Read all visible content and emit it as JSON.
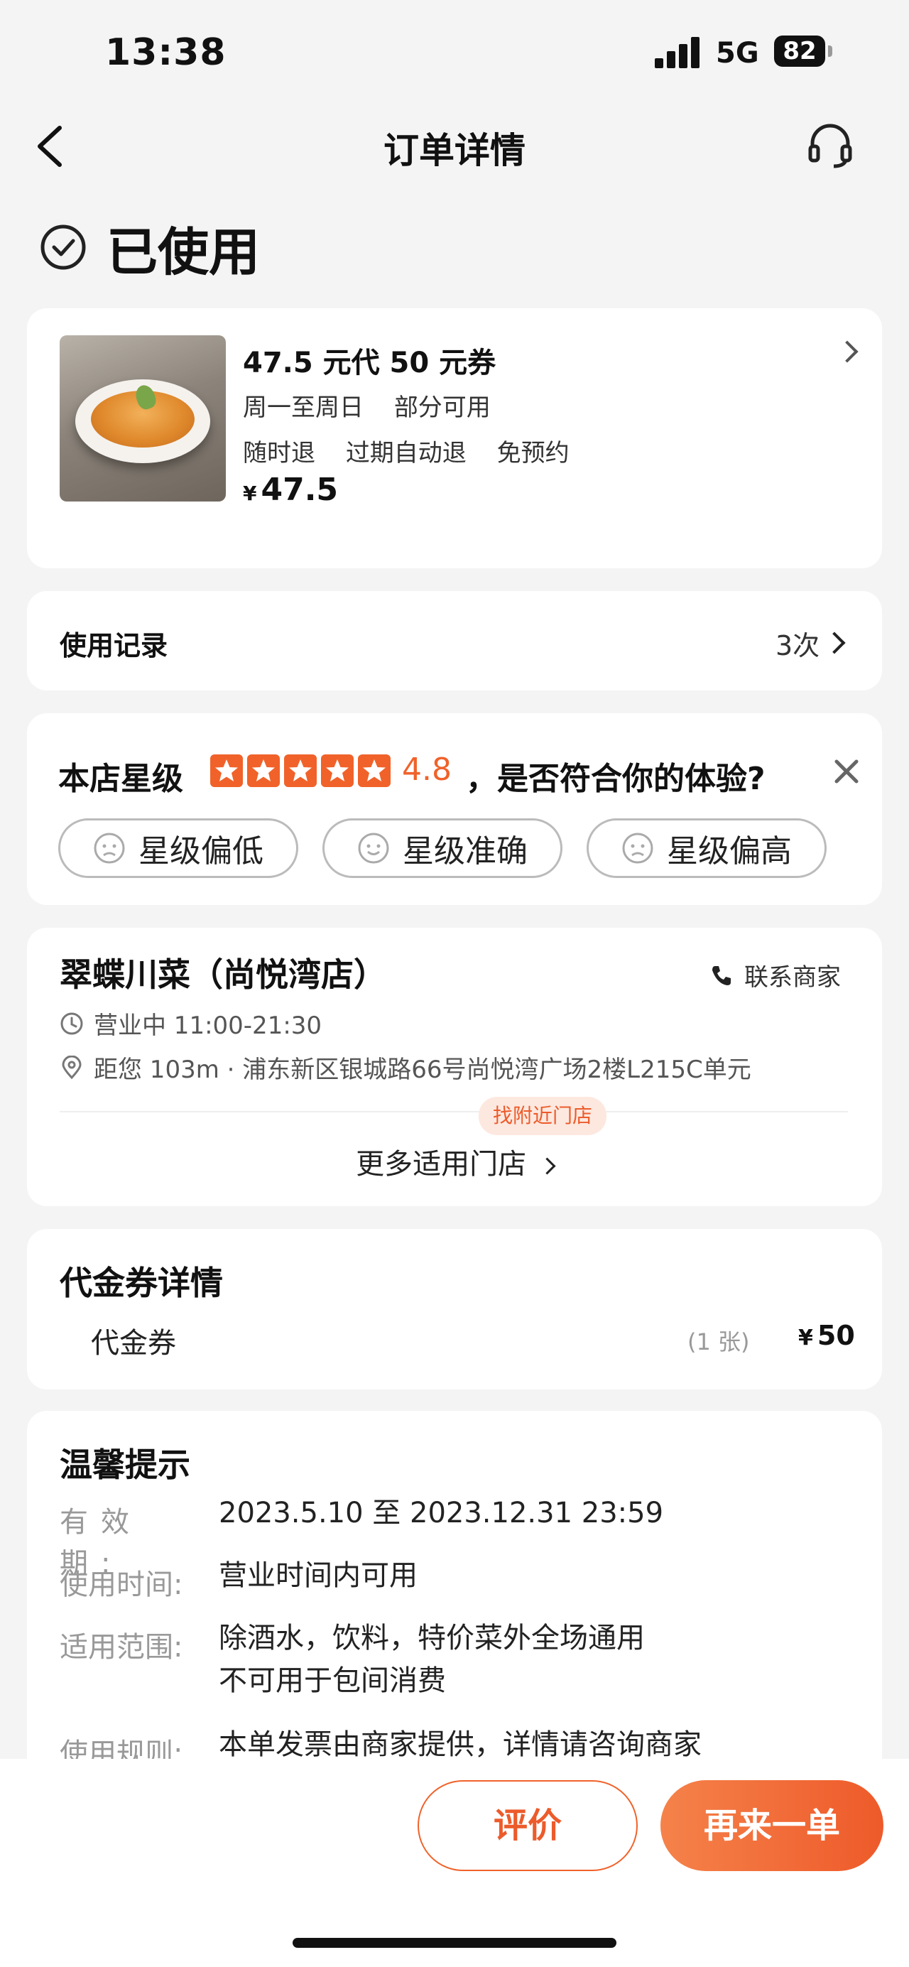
{
  "status_bar": {
    "time": "13:38",
    "network": "5G",
    "battery": "82"
  },
  "nav": {
    "title": "订单详情",
    "back_icon": "chevron-left-icon",
    "service_icon": "headset-icon"
  },
  "order_status": {
    "label": "已使用",
    "icon": "check-circle-icon"
  },
  "product": {
    "title": "47.5 元代 50 元券",
    "line1": [
      "周一至周日",
      "部分可用"
    ],
    "line2": [
      "随时退",
      "过期自动退",
      "免预约"
    ],
    "currency": "¥",
    "price": "47.5"
  },
  "usage_record": {
    "label": "使用记录",
    "count": "3次"
  },
  "rating": {
    "label": "本店星级",
    "stars": 5,
    "score": "4.8",
    "question": "，是否符合你的体验?",
    "options": [
      "星级偏低",
      "星级准确",
      "星级偏高"
    ]
  },
  "store": {
    "name": "翠蝶川菜（尚悦湾店）",
    "contact": "联系商家",
    "hours": "营业中 11:00-21:30",
    "address": "距您 103m · 浦东新区银城路66号尚悦湾广场2楼L215C单元",
    "nearby_tag": "找附近门店",
    "more_stores": "更多适用门店"
  },
  "voucher": {
    "title": "代金券详情",
    "name": "代金券",
    "qty": "(1 张)",
    "currency": "¥",
    "price": "50"
  },
  "notice": {
    "title": "温馨提示",
    "rows": [
      {
        "label": "有效期:",
        "value": "2023.5.10 至 2023.12.31 23:59"
      },
      {
        "label": "使用时间:",
        "value": "营业时间内可用"
      },
      {
        "label": "适用范围:",
        "value": "除酒水，饮料，特价菜外全场通用",
        "value2": "不可用于包间消费"
      },
      {
        "label": "使用规则:",
        "value": "本单发票由商家提供，详情请咨询商家"
      }
    ]
  },
  "actions": {
    "review": "评价",
    "reorder": "再来一单"
  },
  "colors": {
    "accent": "#ec5b2b",
    "star": "#f0622a"
  }
}
